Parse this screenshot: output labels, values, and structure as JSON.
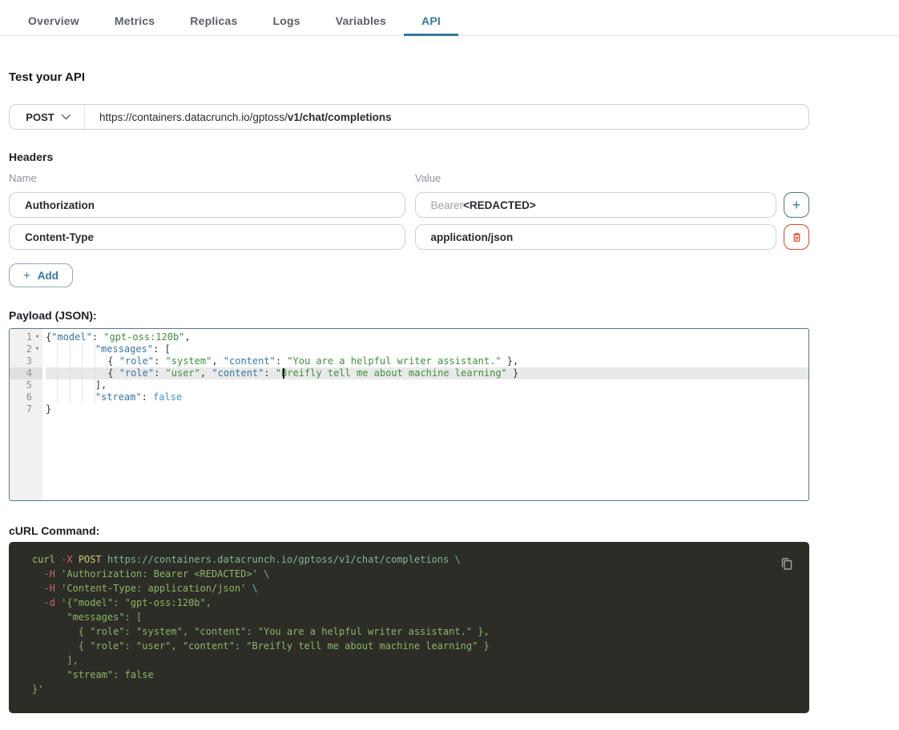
{
  "tabs": {
    "items": [
      {
        "label": "Overview",
        "active": false
      },
      {
        "label": "Metrics",
        "active": false
      },
      {
        "label": "Replicas",
        "active": false
      },
      {
        "label": "Logs",
        "active": false
      },
      {
        "label": "Variables",
        "active": false
      },
      {
        "label": "API",
        "active": true
      }
    ]
  },
  "page_title": "Test your API",
  "request": {
    "method": "POST",
    "url_base": "https://containers.datacrunch.io/gptoss/",
    "url_path_bold": "v1/chat/completions"
  },
  "headers": {
    "title": "Headers",
    "name_label": "Name",
    "value_label": "Value",
    "add_icon": "+",
    "add_label": "Add",
    "rows": [
      {
        "name": "Authorization",
        "value_muted": "Bearer ",
        "value_strong": "<REDACTED>",
        "action": "add"
      },
      {
        "name": "Content-Type",
        "value_muted": "",
        "value_strong": "application/json",
        "action": "delete"
      }
    ]
  },
  "payload": {
    "label": "Payload (JSON):",
    "fold_lines": [
      1,
      2
    ],
    "active_line": 4,
    "cursor": {
      "line": 4,
      "column": 41
    },
    "lines": [
      "{\"model\": \"gpt-oss:120b\",",
      "        \"messages\": [",
      "          { \"role\": \"system\", \"content\": \"You are a helpful writer assistant.\" },",
      "          { \"role\": \"user\", \"content\": \"Breifly tell me about machine learning\" }",
      "        ],",
      "        \"stream\": false",
      "}"
    ]
  },
  "curl": {
    "label": "cURL Command:",
    "copy_icon": "copy",
    "lines": [
      "curl -X POST https://containers.datacrunch.io/gptoss/v1/chat/completions \\",
      "  -H 'Authorization: Bearer <REDACTED>' \\",
      "  -H 'Content-Type: application/json' \\",
      "  -d '{\"model\": \"gpt-oss:120b\",",
      "      \"messages\": [",
      "        { \"role\": \"system\", \"content\": \"You are a helpful writer assistant.\" },",
      "        { \"role\": \"user\", \"content\": \"Breifly tell me about machine learning\" }",
      "      ],",
      "      \"stream\": false",
      "}'"
    ]
  },
  "colors": {
    "accent": "#35789b",
    "danger": "#d9472b",
    "editor_border": "#4c7c8e",
    "curl_background": "#2d2d28",
    "json_key": "#3677a6",
    "json_string": "#3f8f3f",
    "json_constant": "#4a90cf"
  }
}
